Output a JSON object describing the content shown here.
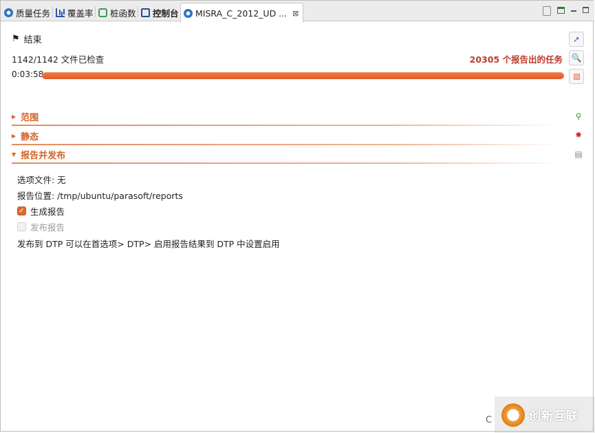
{
  "tabs": [
    {
      "label": "质量任务",
      "icon": "quality-tasks-icon"
    },
    {
      "label": "覆盖率",
      "icon": "coverage-icon"
    },
    {
      "label": "桩函数",
      "icon": "stub-icon"
    },
    {
      "label": "控制台",
      "icon": "console-icon"
    },
    {
      "label": "MISRA_C_2012_UD ...",
      "icon": "misra-icon",
      "active": true,
      "close": "⊠"
    }
  ],
  "status": {
    "label": "结束",
    "files_checked": "1142/1142 文件已检查",
    "report_tasks": "20305 个报告出的任务",
    "elapsed": "0:03:58",
    "progress": 1.0
  },
  "sections": [
    {
      "label": "范围",
      "expanded": false
    },
    {
      "label": "静态",
      "expanded": false
    },
    {
      "label": "报告并发布",
      "expanded": true
    }
  ],
  "report_section": {
    "options_file": "选项文件: 无",
    "report_location": "报告位置: /tmp/ubuntu/parasoft/reports",
    "generate_report_label": "生成报告",
    "generate_report_checked": true,
    "publish_report_label": "发布报告",
    "publish_report_checked": false,
    "dtp_note": "发布到 DTP 可以在首选项> DTP> 启用报告结果到 DTP 中设置启用"
  },
  "footer_letter": "C",
  "watermark_text": "创新互联",
  "colors": {
    "accent": "#e05a25",
    "section": "#d4622a",
    "report_count": "#c0392b"
  }
}
